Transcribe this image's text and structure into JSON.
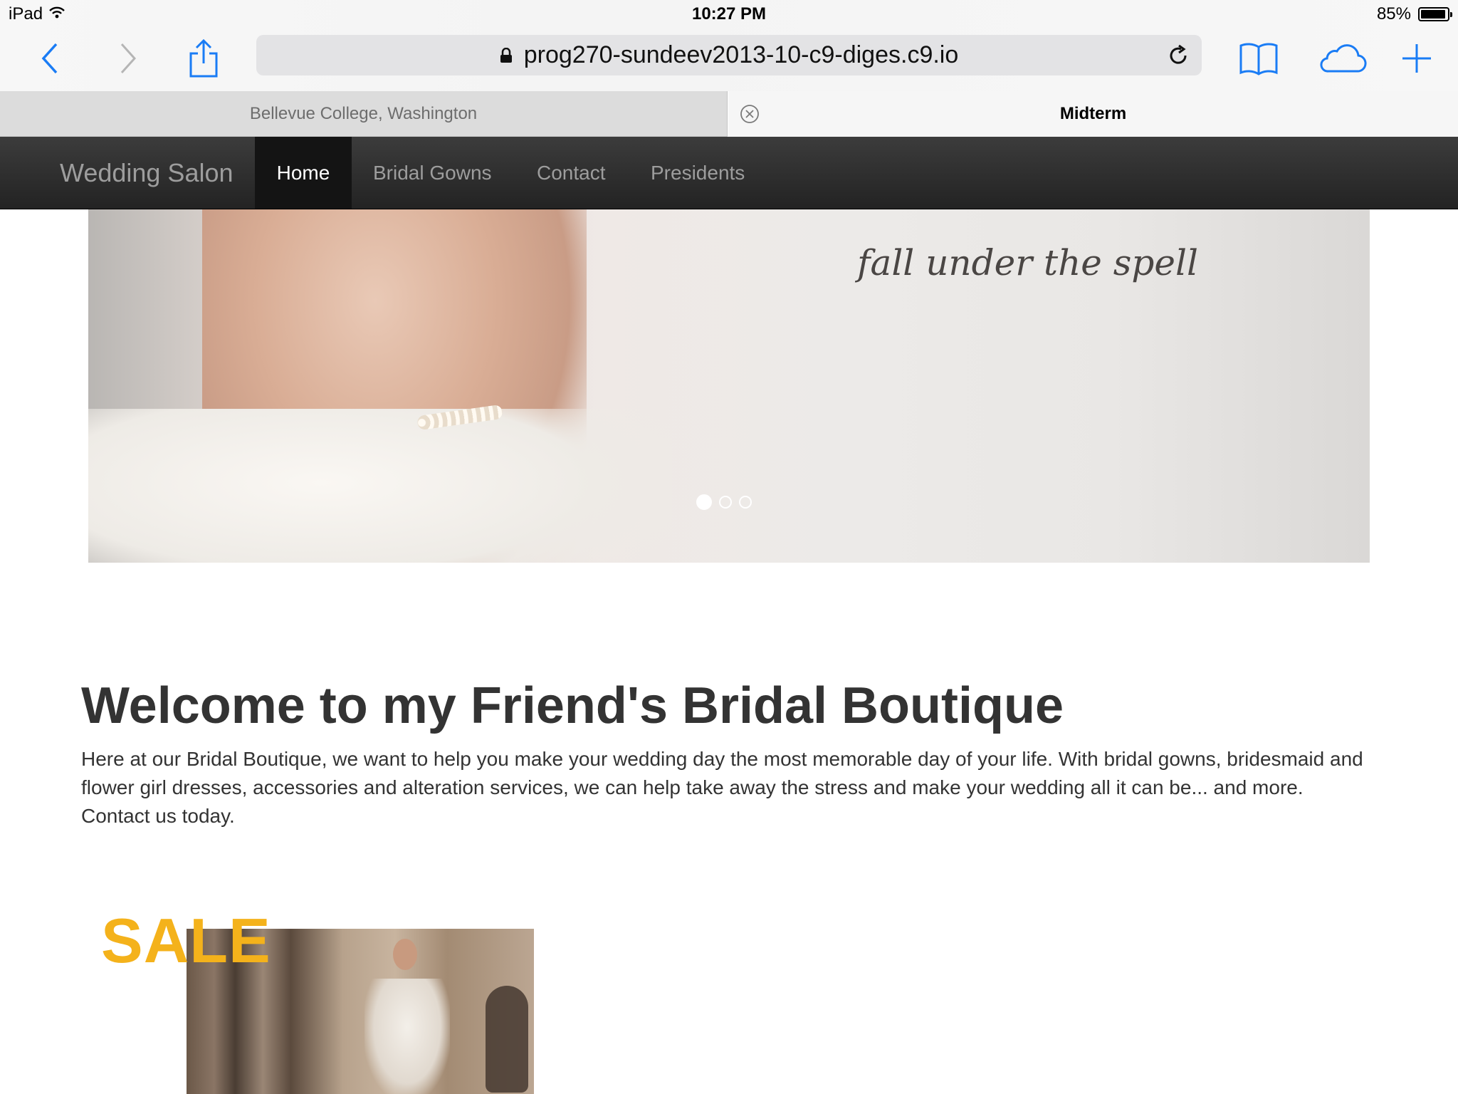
{
  "status": {
    "device": "iPad",
    "time": "10:27 PM",
    "battery": "85%"
  },
  "browser": {
    "url": "prog270-sundeev2013-10-c9-diges.c9.io"
  },
  "tabs": [
    {
      "label": "Bellevue College, Washington",
      "active": false
    },
    {
      "label": "Midterm",
      "active": true
    }
  ],
  "navbar": {
    "brand": "Wedding Salon",
    "items": [
      {
        "label": "Home",
        "active": true
      },
      {
        "label": "Bridal Gowns",
        "active": false
      },
      {
        "label": "Contact",
        "active": false
      },
      {
        "label": "Presidents",
        "active": false
      }
    ]
  },
  "carousel": {
    "caption": "fall under the spell",
    "slides": 3,
    "active_slide": 1
  },
  "main": {
    "heading": "Welcome to my Friend's Bridal Boutique",
    "intro": "Here at our Bridal Boutique, we want to help you make your wedding day the most memorable day of your life. With bridal gowns, bridesmaid and flower girl dresses, accessories and alteration services, we can help take away the stress and make your wedding all it can be... and more. Contact us today.",
    "sale_label": "SALE"
  },
  "colors": {
    "accent": "#1a7cf5",
    "navbar": "#222222",
    "sale": "#f4b21b"
  }
}
